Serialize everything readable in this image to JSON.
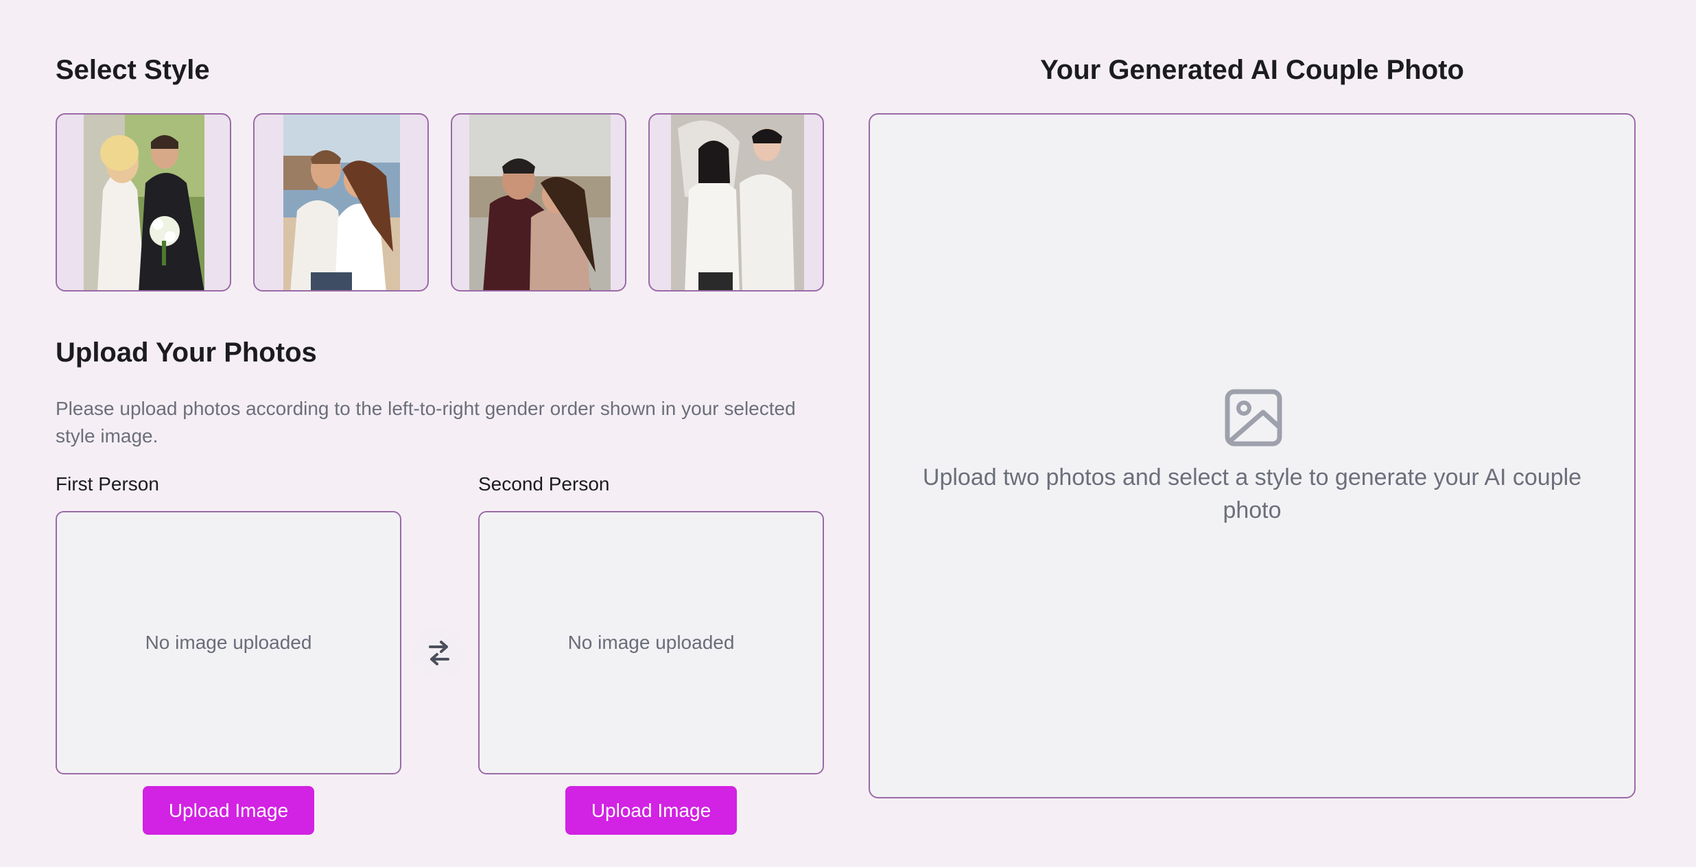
{
  "style_section": {
    "title": "Select Style",
    "styles": [
      {
        "name": "wedding-couple"
      },
      {
        "name": "beach-couple"
      },
      {
        "name": "road-couple"
      },
      {
        "name": "white-outfit-couple"
      }
    ]
  },
  "upload_section": {
    "title": "Upload Your Photos",
    "description": "Please upload photos according to the left-to-right gender order shown in your selected style image.",
    "first_person": {
      "label": "First Person",
      "empty_text": "No image uploaded",
      "button_label": "Upload Image"
    },
    "second_person": {
      "label": "Second Person",
      "empty_text": "No image uploaded",
      "button_label": "Upload Image"
    },
    "swap_icon": "swap-arrows-icon"
  },
  "result_section": {
    "title": "Your Generated AI Couple Photo",
    "placeholder_text": "Upload two photos and select a style to generate your AI couple photo",
    "placeholder_icon": "image-icon"
  },
  "colors": {
    "background": "#f5eff5",
    "accent_border": "#9b6aa6",
    "button": "#d222e3",
    "muted_text": "#6c6f7a"
  }
}
